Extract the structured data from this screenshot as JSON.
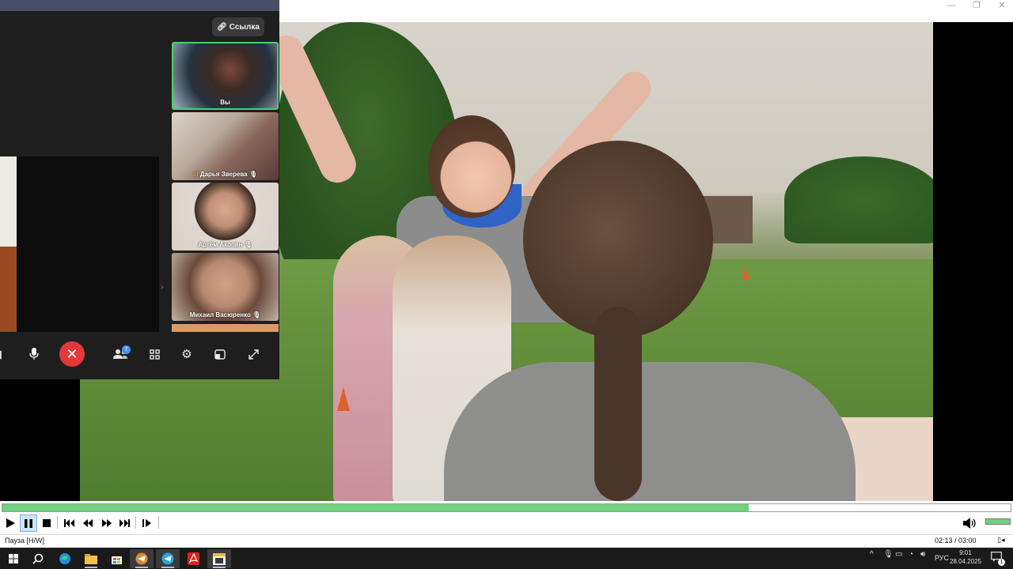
{
  "call": {
    "link_button": "Ссылка",
    "participants": [
      {
        "name": "Вы"
      },
      {
        "name": "Дарья Зверева"
      },
      {
        "name": "Артём Акопян"
      },
      {
        "name": "Михаил Васюренко"
      }
    ],
    "participants_badge": "7"
  },
  "player": {
    "progress_fraction": 0.74,
    "volume_fraction": 1.0,
    "status": "Пауза [H/W]",
    "time": "02:13 / 03:00",
    "ratio_icon": "ratio-icon"
  },
  "taskbar": {
    "lang": "РУС",
    "time": "9:01",
    "date": "28.04.2025",
    "notification_count": "1"
  },
  "colors": {
    "accent_green": "#6fd07e",
    "end_call_red": "#e5383b",
    "active_tile_border": "#4bd06a"
  }
}
